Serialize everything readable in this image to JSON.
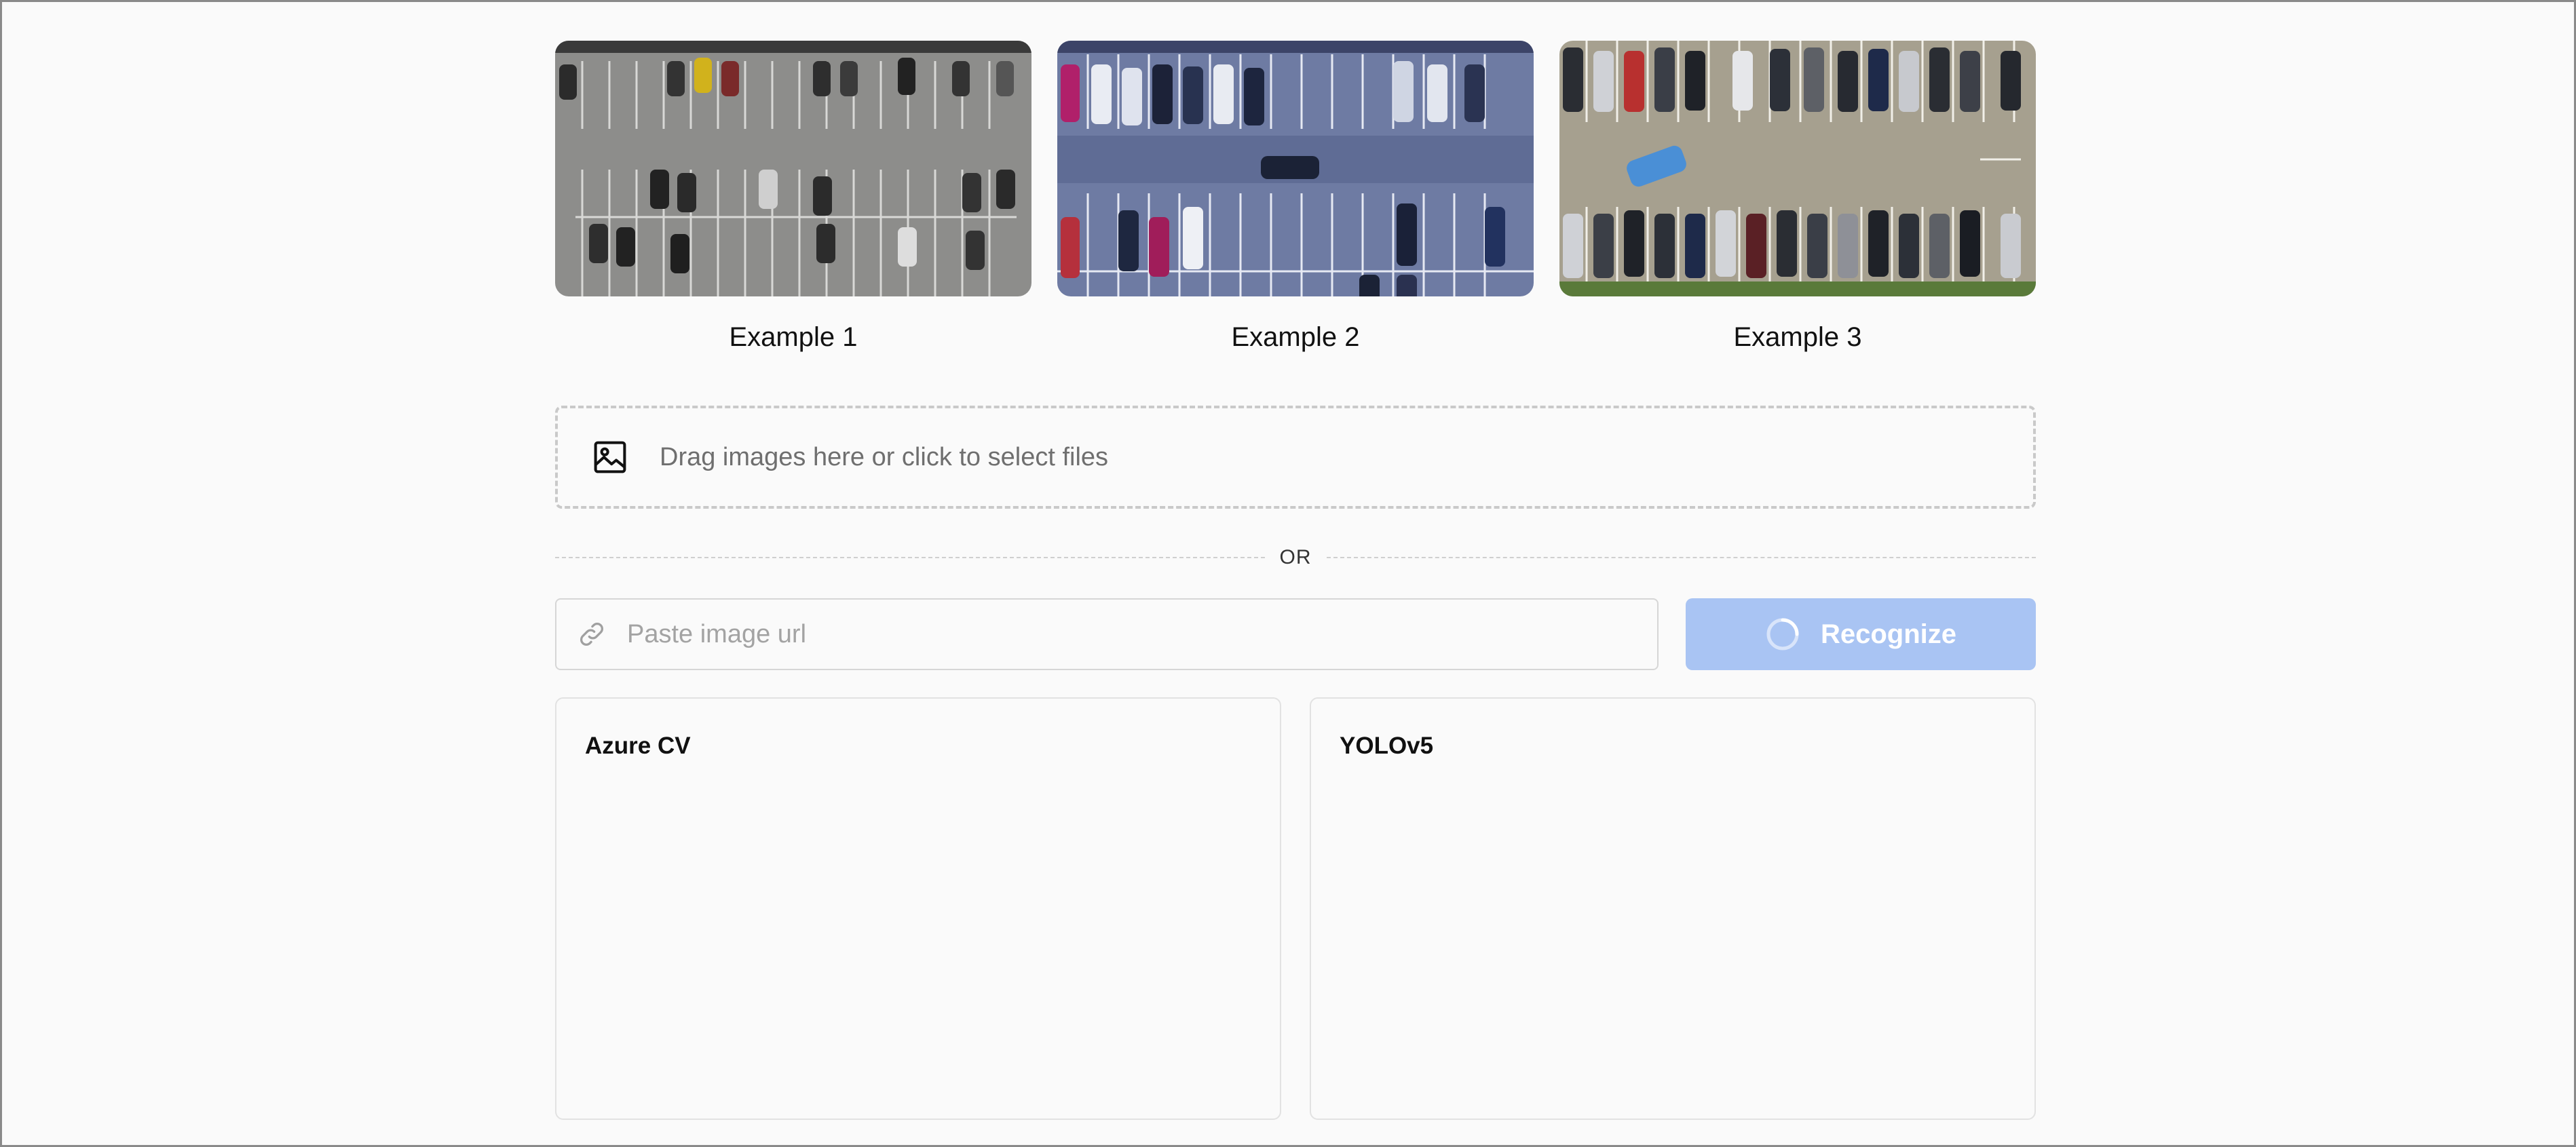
{
  "examples": [
    {
      "label": "Example 1",
      "image": "parking-lot-aerial-gray"
    },
    {
      "label": "Example 2",
      "image": "parking-lot-aerial-blue"
    },
    {
      "label": "Example 3",
      "image": "parking-lot-aerial-tan"
    }
  ],
  "dropzone": {
    "icon": "image-icon",
    "text": "Drag images here or click to select files"
  },
  "divider": {
    "text": "OR"
  },
  "url_input": {
    "icon": "link-icon",
    "placeholder": "Paste image url",
    "value": ""
  },
  "recognize_button": {
    "label": "Recognize",
    "icon": "spinner-icon",
    "color": "#a9c4f3"
  },
  "results": {
    "left_title": "Azure CV",
    "right_title": "YOLOv5"
  }
}
